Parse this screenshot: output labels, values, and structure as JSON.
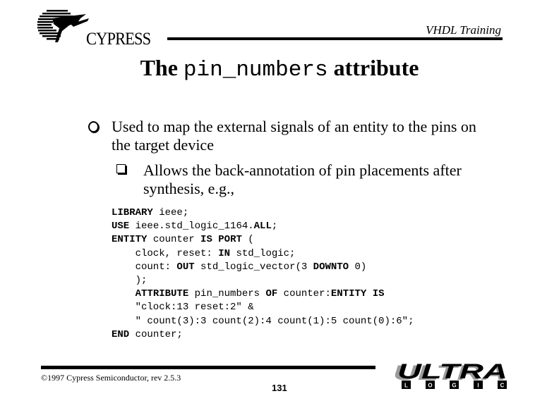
{
  "header": {
    "company": "CYPRESS",
    "course": "VHDL Training"
  },
  "title": {
    "prefix": "The",
    "code": "pin_numbers",
    "suffix": "attribute"
  },
  "bullets": [
    {
      "icon": "circle-bullet-icon",
      "text": "Used to map the external signals of an entity to the pins on the target device"
    },
    {
      "icon": "square-bullet-icon",
      "text": "Allows the back-annotation of pin placements after synthesis, e.g.,"
    }
  ],
  "code": [
    [
      {
        "kw": true,
        "t": "LIBRARY"
      },
      {
        "kw": false,
        "t": " ieee;"
      }
    ],
    [
      {
        "kw": true,
        "t": "USE"
      },
      {
        "kw": false,
        "t": " ieee.std_logic_1164."
      },
      {
        "kw": true,
        "t": "ALL"
      },
      {
        "kw": false,
        "t": ";"
      }
    ],
    [
      {
        "kw": true,
        "t": "ENTITY"
      },
      {
        "kw": false,
        "t": " counter "
      },
      {
        "kw": true,
        "t": "IS"
      },
      {
        "kw": false,
        "t": " "
      },
      {
        "kw": true,
        "t": "PORT"
      },
      {
        "kw": false,
        "t": " ("
      }
    ],
    [
      {
        "kw": false,
        "t": "    clock, reset: "
      },
      {
        "kw": true,
        "t": "IN"
      },
      {
        "kw": false,
        "t": " std_logic;"
      }
    ],
    [
      {
        "kw": false,
        "t": "    count: "
      },
      {
        "kw": true,
        "t": "OUT"
      },
      {
        "kw": false,
        "t": " std_logic_vector(3 "
      },
      {
        "kw": true,
        "t": "DOWNTO"
      },
      {
        "kw": false,
        "t": " 0)"
      }
    ],
    [
      {
        "kw": false,
        "t": "    );"
      }
    ],
    [
      {
        "kw": false,
        "t": "    "
      },
      {
        "kw": true,
        "t": "ATTRIBUTE"
      },
      {
        "kw": false,
        "t": " pin_numbers "
      },
      {
        "kw": true,
        "t": "OF"
      },
      {
        "kw": false,
        "t": " counter:"
      },
      {
        "kw": true,
        "t": "ENTITY IS"
      }
    ],
    [
      {
        "kw": false,
        "t": "    \"clock:13 reset:2\" &"
      }
    ],
    [
      {
        "kw": false,
        "t": "    \" count(3):3 count(2):4 count(1):5 count(0):6\";"
      }
    ],
    [
      {
        "kw": true,
        "t": "END"
      },
      {
        "kw": false,
        "t": " counter;"
      }
    ]
  ],
  "footer": {
    "copyright": "©1997 Cypress Semiconductor, rev 2.5.3",
    "page_number": "131",
    "logo_top": "ULTRA",
    "logo_letters": [
      "L",
      "O",
      "G",
      "I",
      "C"
    ]
  }
}
